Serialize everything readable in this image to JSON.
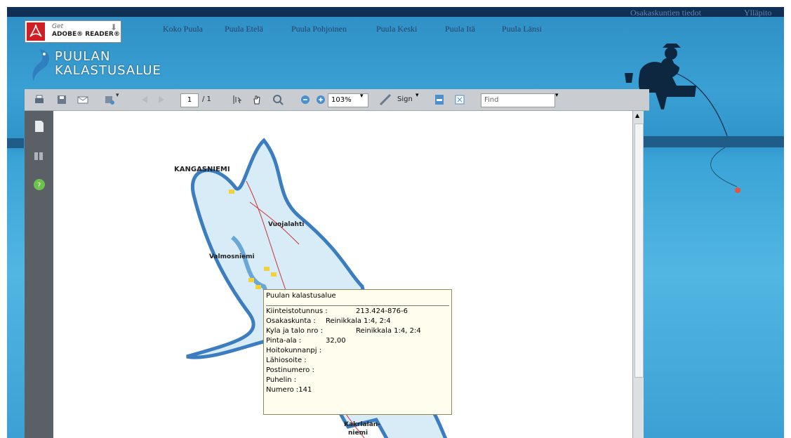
{
  "header": {
    "top_links": [
      "Osakaskuntien tiedot",
      "Ylläpito"
    ],
    "nav": [
      "Koko Puula",
      "Puula Etelä",
      "Puula Pohjoinen",
      "Puula Keski",
      "Puula Itä",
      "Puula Länsi"
    ],
    "adobe": {
      "get": "Get",
      "reader": "ADOBE® READER®"
    },
    "logo": [
      "PUULAN",
      "KALASTUSALUE"
    ]
  },
  "toolbar": {
    "page_current": "1",
    "page_total": "/ 1",
    "zoom": "103%",
    "sign_label": "Sign",
    "find_placeholder": "Find"
  },
  "map": {
    "labels": [
      "KANGASNIEMI",
      "Vuojalahti",
      "Valmosniemi",
      "Kakrlalan-",
      "niemi"
    ]
  },
  "popup": {
    "title": "Puulan kalastusalue",
    "rows": [
      {
        "label": "Kiinteistotunnus :",
        "value": "213.424-876-6"
      },
      {
        "label": "Osakaskunta :",
        "value": "Reinikkala 1:4, 2:4"
      },
      {
        "label": "Kyla ja talo nro :",
        "value": "Reinikkala 1:4, 2:4"
      },
      {
        "label": "Pinta-ala :",
        "value": "32,00"
      },
      {
        "label": "Hoitokunnanpj :",
        "value": ""
      },
      {
        "label": "Lähiosoite :",
        "value": ""
      },
      {
        "label": "Postinumero :",
        "value": ""
      },
      {
        "label": "Puhelin :",
        "value": ""
      },
      {
        "label": "Numero :141",
        "value": ""
      }
    ]
  },
  "colors": {
    "background_water": "#3aa0d3",
    "topbar": "#0f2f55",
    "toolbar": "#c9cdd2",
    "sidebar": "#5b5f66"
  }
}
